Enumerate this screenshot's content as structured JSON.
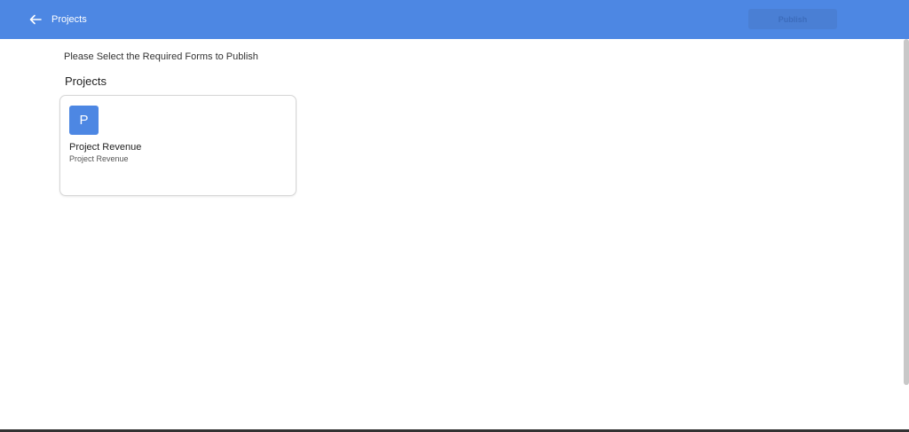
{
  "header": {
    "title": "Projects",
    "publish_label": "Publish",
    "accent_color": "#4d87e3"
  },
  "main": {
    "instruction": "Please Select the Required Forms to Publish",
    "section_title": "Projects",
    "cards": [
      {
        "avatar_letter": "P",
        "title": "Project Revenue",
        "subtitle": "Project Revenue"
      }
    ]
  },
  "icons": {
    "back": "arrow-left-icon"
  }
}
